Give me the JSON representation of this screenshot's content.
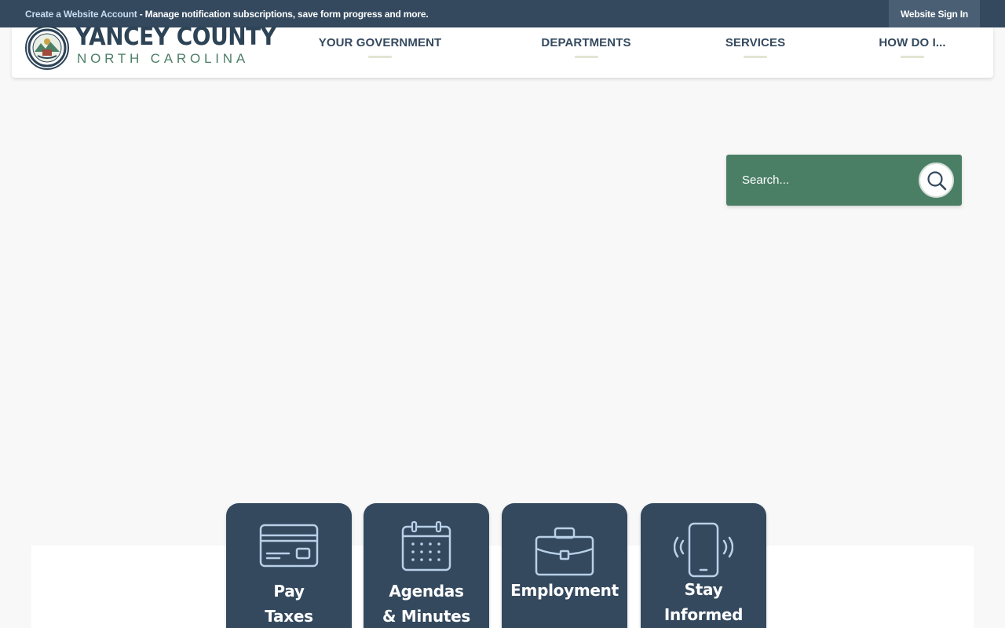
{
  "topbar": {
    "create_link": "Create a Website Account",
    "message": " - Manage notification subscriptions, save form progress and more.",
    "signin": "Website Sign In"
  },
  "logo": {
    "title": "YANCEY COUNTY",
    "subtitle": "NORTH CAROLINA"
  },
  "nav": [
    {
      "label": "YOUR GOVERNMENT"
    },
    {
      "label": "DEPARTMENTS"
    },
    {
      "label": "SERVICES"
    },
    {
      "label": "HOW DO I..."
    }
  ],
  "search": {
    "placeholder": "Search...",
    "button_icon": "search-icon"
  },
  "tiles": [
    {
      "label": "Pay\nTaxes",
      "icon": "credit-card-icon"
    },
    {
      "label": "Agendas\n& Minutes",
      "icon": "calendar-icon"
    },
    {
      "label": "Employment",
      "icon": "briefcase-icon"
    },
    {
      "label": "Stay\nInformed",
      "icon": "phone-notification-icon"
    }
  ],
  "colors": {
    "navy": "#34495e",
    "green": "#4a7f66",
    "background": "#f8f8f8",
    "tile_icon": "#b8d0e8"
  }
}
